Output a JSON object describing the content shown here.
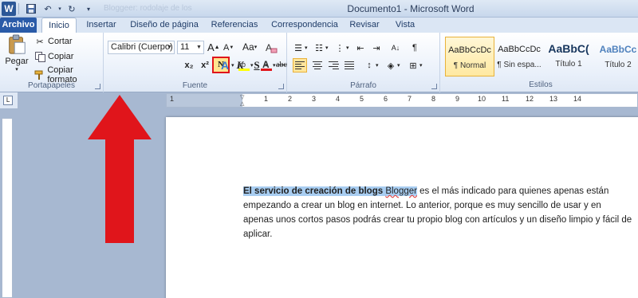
{
  "titlebar": {
    "title": "Documento1 - Microsoft Word",
    "ghost_title": "Bloggeer: rodolaje de los",
    "app_icon": "word-icon"
  },
  "tabs": [
    {
      "label": "Archivo"
    },
    {
      "label": "Inicio"
    },
    {
      "label": "Insertar"
    },
    {
      "label": "Diseño de página"
    },
    {
      "label": "Referencias"
    },
    {
      "label": "Correspondencia"
    },
    {
      "label": "Revisar"
    },
    {
      "label": "Vista"
    }
  ],
  "ribbon": {
    "clipboard": {
      "group_label": "Portapapeles",
      "paste_label": "Pegar",
      "cut_label": "Cortar",
      "copy_label": "Copiar",
      "format_painter_label": "Copiar formato"
    },
    "font": {
      "group_label": "Fuente",
      "font_name": "Calibri (Cuerpo)",
      "font_size": "11",
      "bold_label": "N",
      "italic_label": "K",
      "underline_label": "S",
      "strike_label": "abc",
      "subscript_label": "x₂",
      "superscript_label": "x²",
      "change_case_label": "Aa",
      "grow_label": "A",
      "shrink_label": "A"
    },
    "paragraph": {
      "group_label": "Párrafo"
    },
    "styles": {
      "group_label": "Estilos",
      "items": [
        {
          "sample": "AaBbCcDc",
          "name": "¶ Normal"
        },
        {
          "sample": "AaBbCcDc",
          "name": "¶ Sin espa..."
        },
        {
          "sample": "AaBbC(",
          "name": "Título 1"
        },
        {
          "sample": "AaBbCc",
          "name": "Título 2"
        }
      ]
    }
  },
  "ruler": {
    "labels": [
      "1",
      "1",
      "2",
      "3",
      "4",
      "5",
      "6",
      "7",
      "8",
      "9",
      "10",
      "11",
      "12",
      "13",
      "14"
    ]
  },
  "document": {
    "highlight_bold": "El servicio de creación de blogs",
    "highlight_plain": "Blogger",
    "line1_rest": " es el más indicado para quienes apenas están",
    "line2": "empezando a crear un blog en internet. Lo anterior, porque es muy sencillo de usar y en",
    "line3": "apenas unos cortos pasos podrás crear tu propio blog con artículos y un diseño limpio y fácil de",
    "line4": "aplicar."
  },
  "colors": {
    "accent": "#2a5ba8",
    "highlight": "#a8cdf1",
    "annotation_red": "#e0151b"
  }
}
